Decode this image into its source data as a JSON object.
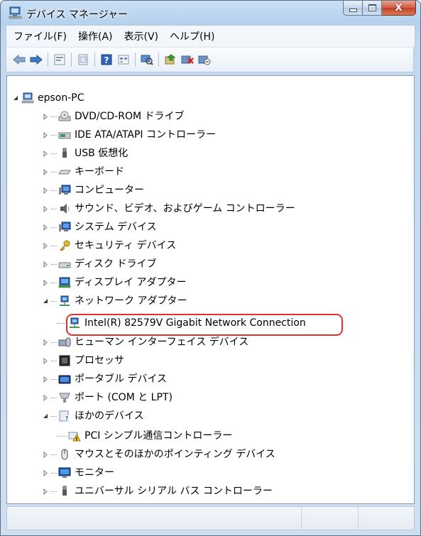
{
  "window": {
    "title": "デバイス マネージャー",
    "controls": {
      "minimize_symbol": "▁",
      "maximize_symbol": "□",
      "close_symbol": "X"
    }
  },
  "menu": [
    {
      "label": "ファイル(F)"
    },
    {
      "label": "操作(A)"
    },
    {
      "label": "表示(V)"
    },
    {
      "label": "ヘルプ(H)"
    }
  ],
  "toolbar": {
    "buttons": [
      "back-arrow-icon",
      "forward-arrow-icon",
      "properties-icon",
      "show-hide-icon",
      "help-icon",
      "view-icon",
      "scan-hardware-icon",
      "update-driver-icon",
      "uninstall-icon",
      "disable-icon"
    ]
  },
  "tree": {
    "root": "epson-PC",
    "items": [
      {
        "label": "DVD/CD-ROM ドライブ",
        "icon": "optical-drive-icon",
        "expanded": false
      },
      {
        "label": "IDE ATA/ATAPI コントローラー",
        "icon": "ide-controller-icon",
        "expanded": false
      },
      {
        "label": "USB 仮想化",
        "icon": "usb-icon",
        "expanded": false
      },
      {
        "label": "キーボード",
        "icon": "keyboard-icon",
        "expanded": false
      },
      {
        "label": "コンピューター",
        "icon": "computer-icon",
        "expanded": false
      },
      {
        "label": "サウンド、ビデオ、およびゲーム コントローラー",
        "icon": "speaker-icon",
        "expanded": false
      },
      {
        "label": "システム デバイス",
        "icon": "system-device-icon",
        "expanded": false
      },
      {
        "label": "セキュリティ デバイス",
        "icon": "key-icon",
        "expanded": false
      },
      {
        "label": "ディスク ドライブ",
        "icon": "disk-drive-icon",
        "expanded": false
      },
      {
        "label": "ディスプレイ アダプター",
        "icon": "display-adapter-icon",
        "expanded": false
      },
      {
        "label": "ネットワーク アダプター",
        "icon": "network-adapter-icon",
        "expanded": true,
        "children": [
          {
            "label": "Intel(R) 82579V Gigabit Network Connection",
            "icon": "network-card-icon",
            "highlighted": true
          }
        ]
      },
      {
        "label": "ヒューマン インターフェイス デバイス",
        "icon": "hid-icon",
        "expanded": false
      },
      {
        "label": "プロセッサ",
        "icon": "processor-icon",
        "expanded": false
      },
      {
        "label": "ポータブル デバイス",
        "icon": "portable-device-icon",
        "expanded": false
      },
      {
        "label": "ポート (COM と LPT)",
        "icon": "port-icon",
        "expanded": false
      },
      {
        "label": "ほかのデバイス",
        "icon": "other-device-icon",
        "expanded": true,
        "children": [
          {
            "label": "PCI シンプル通信コントローラー",
            "icon": "warning-device-icon",
            "highlighted": false
          }
        ]
      },
      {
        "label": "マウスとそのほかのポインティング デバイス",
        "icon": "mouse-icon",
        "expanded": false
      },
      {
        "label": "モニター",
        "icon": "monitor-icon",
        "expanded": false
      },
      {
        "label": "ユニバーサル シリアル バス コントローラー",
        "icon": "usb-controller-icon",
        "expanded": false
      }
    ]
  },
  "colors": {
    "highlight_ring": "#e03030",
    "window_frame": "#b7d2ee"
  }
}
